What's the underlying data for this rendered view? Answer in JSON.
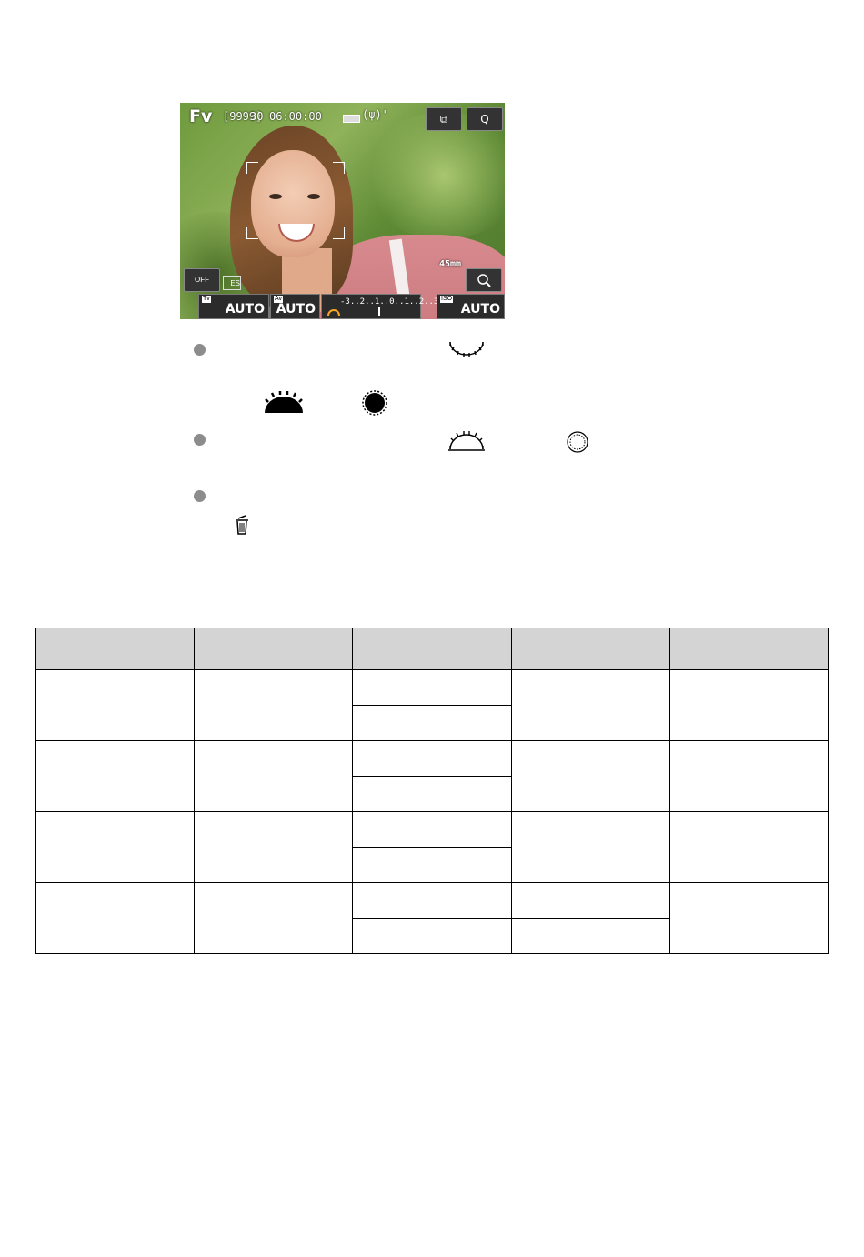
{
  "camera_screen": {
    "mode": "Fv",
    "shots_remaining": "[9999]",
    "shots_extra": "30",
    "timecode": "06:00:00",
    "stabilizer_glyph": "(ψ)'",
    "display_button_label": "⧉",
    "quick_button_label": "Q",
    "focal_length": "45mm",
    "lens_button_label": "OFF",
    "es_label": "ES",
    "tv": {
      "tag": "Tv",
      "value": "AUTO"
    },
    "av": {
      "tag": "Av",
      "value": "AUTO"
    },
    "exposure_scale": "-3..2..1..0..1..2..3",
    "iso": {
      "tag": "ISO",
      "value": "AUTO"
    }
  },
  "icons": {
    "bullet": "bullet-icon",
    "main_dial": "main-dial-icon",
    "quick_control_dial": "quick-control-dial-icon",
    "trash": "trash-icon"
  },
  "table": {
    "headers": [
      "",
      "",
      "",
      "",
      ""
    ],
    "rows": 4
  }
}
